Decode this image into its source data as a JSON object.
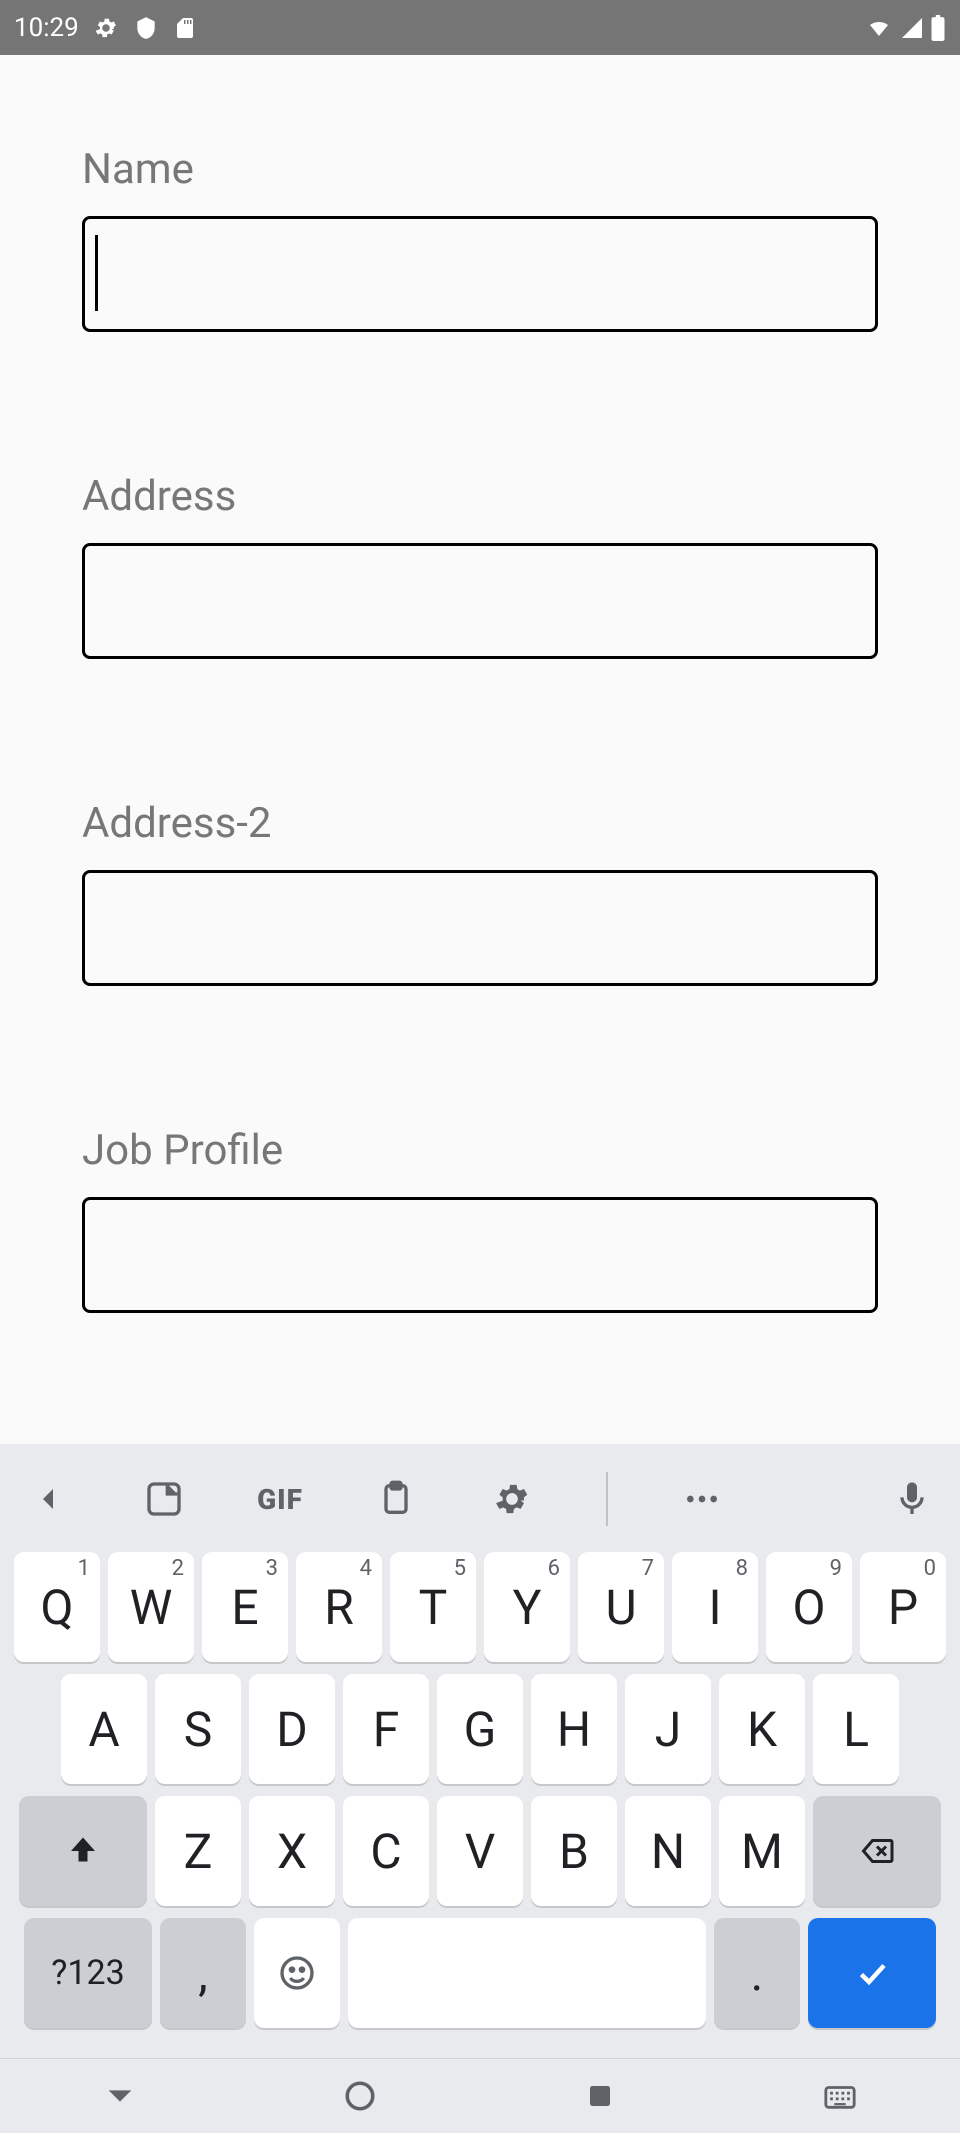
{
  "status": {
    "time": "10:29"
  },
  "colors": {
    "accent": "#1a73e8"
  },
  "form": {
    "fields": [
      {
        "label": "Name",
        "value": "",
        "focused": true
      },
      {
        "label": "Address",
        "value": "",
        "focused": false
      },
      {
        "label": "Address-2",
        "value": "",
        "focused": false
      },
      {
        "label": "Job Profile",
        "value": "",
        "focused": false
      }
    ]
  },
  "keyboard": {
    "tools": [
      "back",
      "sticker",
      "gif",
      "clipboard",
      "settings",
      "more",
      "mic"
    ],
    "row1": [
      {
        "l": "Q",
        "s": "1"
      },
      {
        "l": "W",
        "s": "2"
      },
      {
        "l": "E",
        "s": "3"
      },
      {
        "l": "R",
        "s": "4"
      },
      {
        "l": "T",
        "s": "5"
      },
      {
        "l": "Y",
        "s": "6"
      },
      {
        "l": "U",
        "s": "7"
      },
      {
        "l": "I",
        "s": "8"
      },
      {
        "l": "O",
        "s": "9"
      },
      {
        "l": "P",
        "s": "0"
      }
    ],
    "row2": [
      "A",
      "S",
      "D",
      "F",
      "G",
      "H",
      "J",
      "K",
      "L"
    ],
    "row3": [
      "Z",
      "X",
      "C",
      "V",
      "B",
      "N",
      "M"
    ],
    "row4": {
      "sym": "?123",
      "comma": ",",
      "period": "."
    }
  }
}
